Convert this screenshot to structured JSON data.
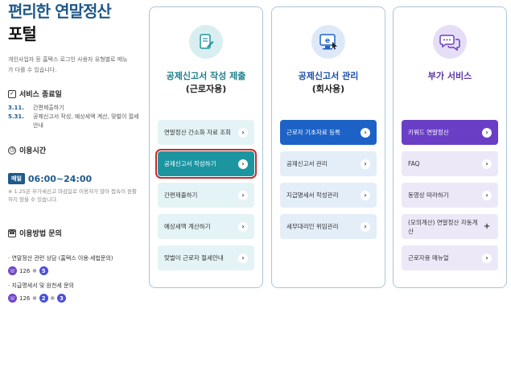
{
  "left": {
    "title_line1": "편리한 연말정산",
    "title_line2": "포털",
    "intro": "개인사업자 등 홈택스 로그인 사용자 유형별로 메뉴가 다를 수 있습니다.",
    "service_end": {
      "heading": "서비스 종료일",
      "items": [
        {
          "date": "3.11.",
          "text": "간편제출하기"
        },
        {
          "date": "5.31.",
          "text": "공제신고서 작성, 예상세액 계산, 맞벌이 절세 안내"
        }
      ]
    },
    "hours": {
      "heading": "이용시간",
      "badge": "매일",
      "time": "06:00~24:00",
      "note": "※ 1.25은 부가세신고 마감일로 이용자가 많아 접속이 원활하지 않을 수 있습니다."
    },
    "inquiry": {
      "heading": "이용방법 문의",
      "items": [
        {
          "label": "· 연말정산 관련 상담 (홈택스 이용·세법문의)",
          "phone": "126",
          "keys": [
            "5"
          ]
        },
        {
          "label": "· 지급명세서 및 원천세 문의",
          "phone": "126",
          "keys": [
            "2",
            "3"
          ]
        }
      ]
    }
  },
  "cards": [
    {
      "title": "공제신고서 작성 제출",
      "subtitle": "(근로자용)",
      "icon": "document-edit-icon",
      "items": [
        {
          "label": "연말정산 간소화 자료 조회",
          "style": "teal"
        },
        {
          "label": "공제신고서 작성하기",
          "style": "teal-active"
        },
        {
          "label": "간편제출하기",
          "style": "teal"
        },
        {
          "label": "예상세액 계산하기",
          "style": "teal"
        },
        {
          "label": "맞벌이 근로자 절세안내",
          "style": "teal"
        }
      ]
    },
    {
      "title": "공제신고서 관리",
      "subtitle": "(회사용)",
      "icon": "computer-e-icon",
      "items": [
        {
          "label": "근로자 기초자료 등록",
          "style": "blue-active"
        },
        {
          "label": "공제신고서 관리",
          "style": "blue"
        },
        {
          "label": "지급명세서 작성관리",
          "style": "blue"
        },
        {
          "label": "세무대리인 위임관리",
          "style": "blue"
        }
      ]
    },
    {
      "title": "부가 서비스",
      "subtitle": "",
      "icon": "chat-bubbles-icon",
      "items": [
        {
          "label": "키워드 연말정산",
          "style": "purple-active"
        },
        {
          "label": "FAQ",
          "style": "purple"
        },
        {
          "label": "동영상 따라하기",
          "style": "purple"
        },
        {
          "label": "(모의계산) 연말정산 자동계산",
          "style": "purple"
        },
        {
          "label": "근로자용 매뉴얼",
          "style": "purple"
        }
      ]
    }
  ],
  "colors": {
    "teal": "#1d95a0",
    "blue": "#1d63c7",
    "purple": "#6a3fc6",
    "highlight": "#c02d2d"
  }
}
